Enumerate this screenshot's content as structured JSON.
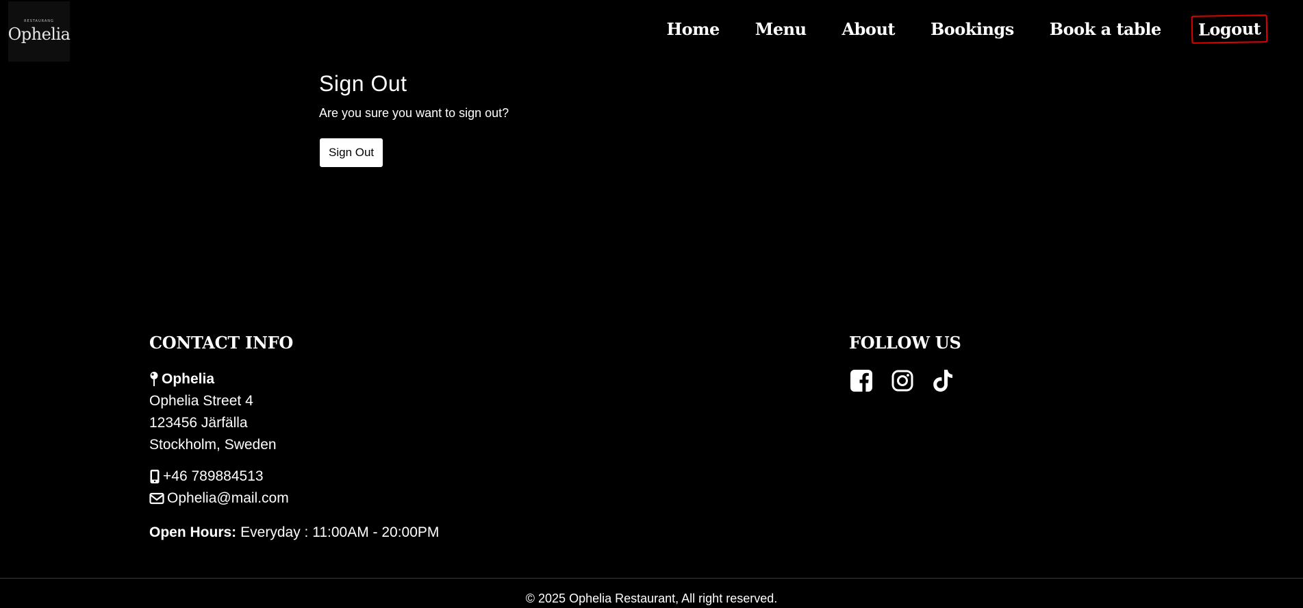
{
  "logo": {
    "small_text": "RESTAURANG",
    "name": "Ophelia"
  },
  "nav": {
    "items": [
      {
        "label": "Home"
      },
      {
        "label": "Menu"
      },
      {
        "label": "About"
      },
      {
        "label": "Bookings"
      },
      {
        "label": "Book a table"
      },
      {
        "label": "Logout"
      }
    ]
  },
  "signout": {
    "title": "Sign Out",
    "prompt": "Are you sure you want to sign out?",
    "button_label": "Sign Out"
  },
  "contact": {
    "heading": "CONTACT INFO",
    "name": "Ophelia",
    "street": "Ophelia Street 4",
    "postal": "123456 Järfälla",
    "city": "Stockholm, Sweden",
    "phone": "+46 789884513",
    "email": "Ophelia@mail.com",
    "hours_label": "Open Hours:",
    "hours_value": "Everyday : 11:00AM - 20:00PM"
  },
  "follow": {
    "heading": "FOLLOW US",
    "icons": [
      "facebook-icon",
      "instagram-icon",
      "tiktok-icon"
    ]
  },
  "footer": {
    "copyright": "© 2025 Ophelia Restaurant, All right reserved."
  },
  "colors": {
    "background": "#000000",
    "text": "#ffffff",
    "active_outline": "#e00000"
  }
}
